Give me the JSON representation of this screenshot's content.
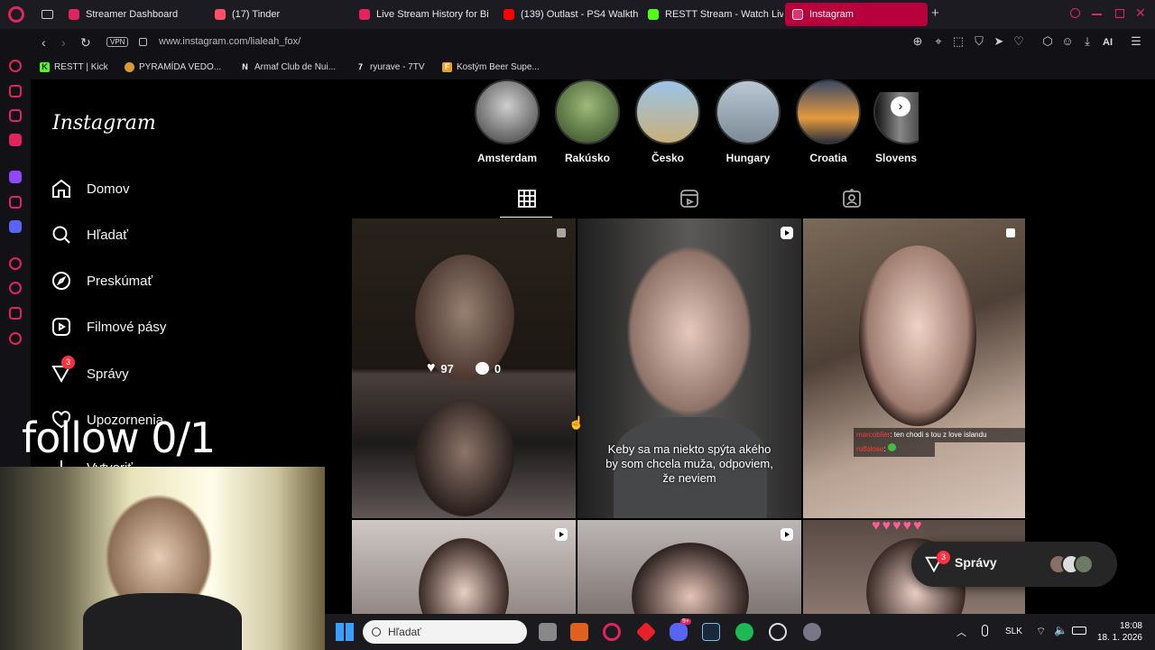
{
  "browser": {
    "tabs": [
      {
        "label": "Streamer Dashboard",
        "fav_color": "#e0245e"
      },
      {
        "label": "(17) Tinder",
        "fav_color": "#fd5068"
      },
      {
        "label": "Live Stream History for Bi",
        "fav_color": "#e0245e"
      },
      {
        "label": "(139) Outlast - PS4 Walkth",
        "fav_color": "#ff0000"
      },
      {
        "label": "RESTT Stream - Watch Liv",
        "fav_color": "#53fc18"
      },
      {
        "label": "Instagram",
        "fav_color": "#e1306c"
      }
    ],
    "vpn_label": "VPN",
    "url": "www.instagram.com/lialeah_fox/",
    "ai_label": "AI",
    "bookmarks": [
      {
        "label": "RESTT | Kick",
        "badge": "K",
        "color": "#53fc18"
      },
      {
        "label": "PYRAMÍDA VEDO...",
        "badge": "",
        "color": "#d79b32"
      },
      {
        "label": "Armaf Club de Nui...",
        "badge": "N",
        "color": "#ffffff"
      },
      {
        "label": "ryurave - 7TV",
        "badge": "7",
        "color": "#ffffff"
      },
      {
        "label": "Kostým Beer Supe...",
        "badge": "F",
        "color": "#f0a020"
      }
    ]
  },
  "instagram": {
    "logo": "Instagram",
    "nav": [
      {
        "label": "Domov",
        "icon": "home-icon"
      },
      {
        "label": "Hľadať",
        "icon": "search-icon"
      },
      {
        "label": "Preskúmať",
        "icon": "compass-icon"
      },
      {
        "label": "Filmové pásy",
        "icon": "reels-icon"
      },
      {
        "label": "Správy",
        "icon": "messenger-icon",
        "badge": "3"
      },
      {
        "label": "Upozornenia",
        "icon": "heart-icon"
      },
      {
        "label": "Vytvoriť",
        "icon": "plus-icon"
      }
    ],
    "highlights": [
      "Amsterdam",
      "Rakúsko",
      "Česko",
      "Hungary",
      "Croatia",
      "Slovens"
    ],
    "tile_stats": {
      "likes": "97",
      "comments": "0"
    },
    "caption": "Keby sa ma niekto spýta akého by som chcela muža, odpoviem, že neviem",
    "chat": [
      {
        "user": "marcoblier",
        "text": ": ten chodi s tou z love islandu"
      },
      {
        "user": "rolfolose",
        "text": ":"
      }
    ],
    "messages_pill": {
      "label": "Správy",
      "badge": "3"
    }
  },
  "stream_overlay": {
    "follow_text": "follow 0/1"
  },
  "taskbar": {
    "search_placeholder": "Hľadať",
    "lang": "SLK",
    "time": "18:08",
    "date": "18. 1. 2026",
    "discord_badge": "9+"
  }
}
